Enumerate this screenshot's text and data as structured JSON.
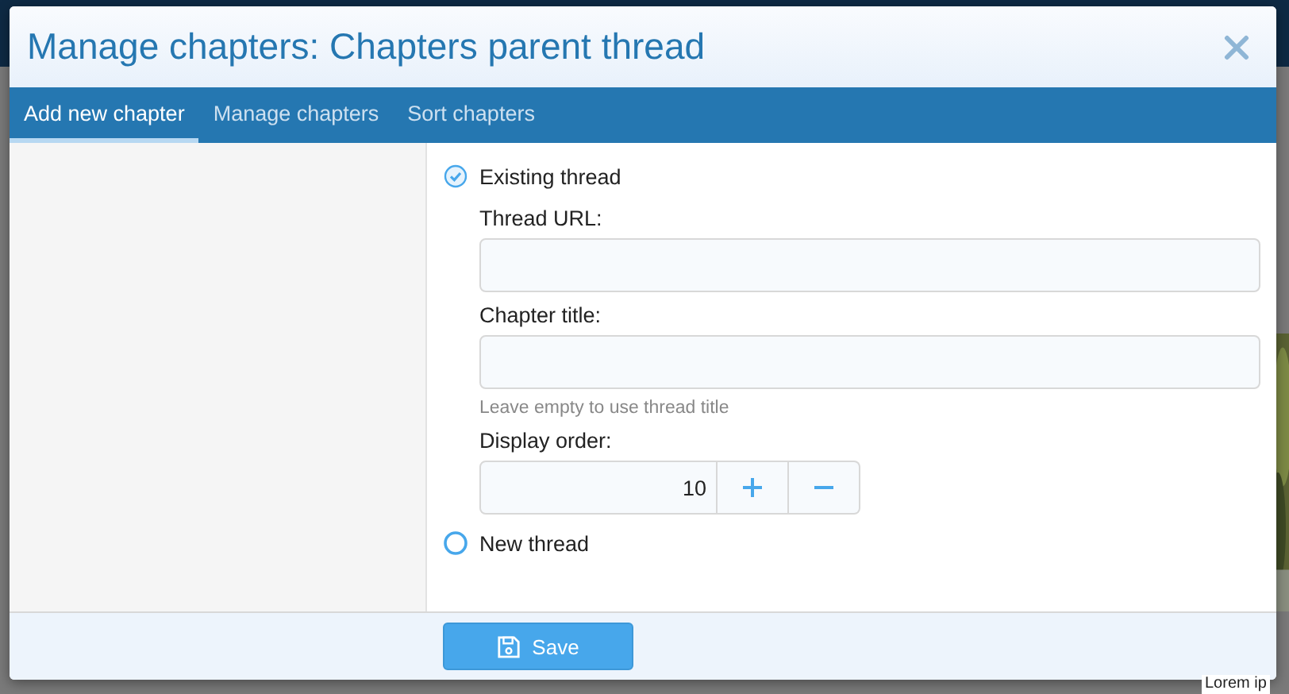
{
  "background": {
    "text": "Lorem ip"
  },
  "modal": {
    "title": "Manage chapters: Chapters parent thread",
    "tabs": [
      {
        "label": "Add new chapter",
        "selected": true
      },
      {
        "label": "Manage chapters",
        "selected": false
      },
      {
        "label": "Sort chapters",
        "selected": false
      }
    ],
    "options": [
      {
        "label": "Existing thread",
        "selected": true,
        "fields": [
          {
            "kind": "text",
            "label": "Thread URL:"
          },
          {
            "kind": "text",
            "label": "Chapter title:",
            "hint": "Leave empty to use thread title"
          },
          {
            "kind": "number",
            "label": "Display order:",
            "value": "10"
          }
        ]
      },
      {
        "label": "New thread",
        "selected": false
      }
    ],
    "save_button": "Save"
  }
}
